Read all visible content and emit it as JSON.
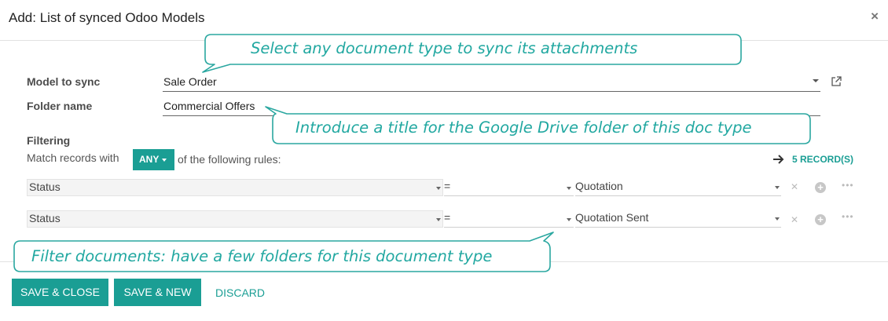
{
  "dialog": {
    "title": "Add: List of synced Odoo Models",
    "close_glyph": "×"
  },
  "form": {
    "model_label": "Model to sync",
    "model_value": "Sale Order",
    "folder_label": "Folder name",
    "folder_value": "Commercial Offers",
    "filtering_label": "Filtering",
    "match_prefix": "Match records with",
    "match_mode": "ANY",
    "match_suffix": "of the following rules:",
    "records_link": "5 RECORD(S)"
  },
  "rules": [
    {
      "field": "Status",
      "operator": "=",
      "value": "Quotation"
    },
    {
      "field": "Status",
      "operator": "=",
      "value": "Quotation Sent"
    }
  ],
  "footer": {
    "save_close": "SAVE & CLOSE",
    "save_new": "SAVE & NEW",
    "discard": "DISCARD"
  },
  "callouts": {
    "model_tip": "Select any document type to sync its attachments",
    "folder_tip": "Introduce a title for the Google Drive folder of this doc type",
    "filter_tip": "Filter documents: have a few folders for this document type"
  },
  "icons": {
    "close": "close-icon",
    "external_link": "external-link-icon",
    "arrow": "arrow-right-icon",
    "delete": "delete-rule-icon",
    "add": "add-rule-icon",
    "more": "more-options-icon"
  },
  "colors": {
    "primary": "#1a9e94",
    "callout_border": "#2aa7a0",
    "callout_text": "#22a8a1"
  }
}
